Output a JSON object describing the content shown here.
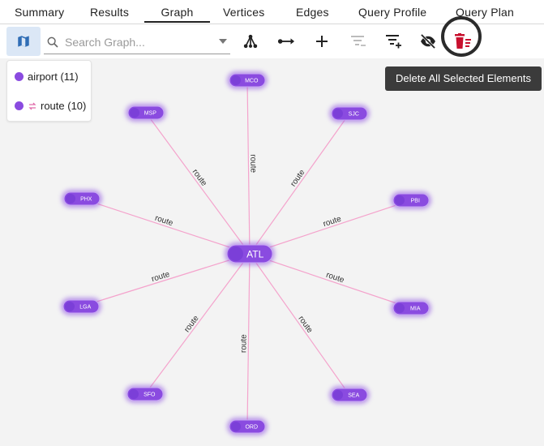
{
  "tabs": [
    {
      "label": "Summary",
      "active": false
    },
    {
      "label": "Results",
      "active": false
    },
    {
      "label": "Graph",
      "active": true
    },
    {
      "label": "Vertices",
      "active": false
    },
    {
      "label": "Edges",
      "active": false
    },
    {
      "label": "Query Profile",
      "active": false
    },
    {
      "label": "Query Plan",
      "active": false
    }
  ],
  "toolbar": {
    "search_placeholder": "Search Graph...",
    "icons": [
      "map-icon",
      "graph-layout-icon",
      "edge-arrow-icon",
      "add-icon",
      "filter-remove-icon",
      "filter-add-icon",
      "visibility-off-icon",
      "delete-selected-icon"
    ]
  },
  "tooltip": {
    "text": "Delete All Selected Elements"
  },
  "legend": {
    "airport": "airport (11)",
    "route": "route (10)"
  },
  "colors": {
    "node": "#8a4be0",
    "edge": "#f4a3cc",
    "active_tab": "#222222",
    "delete_icon": "#c8102e"
  },
  "graph": {
    "center": "ATL",
    "nodes": [
      "MCO",
      "MSP",
      "SJC",
      "PHX",
      "PBI",
      "LGA",
      "MIA",
      "SFO",
      "SEA",
      "ORD"
    ],
    "edge_label": "route"
  }
}
